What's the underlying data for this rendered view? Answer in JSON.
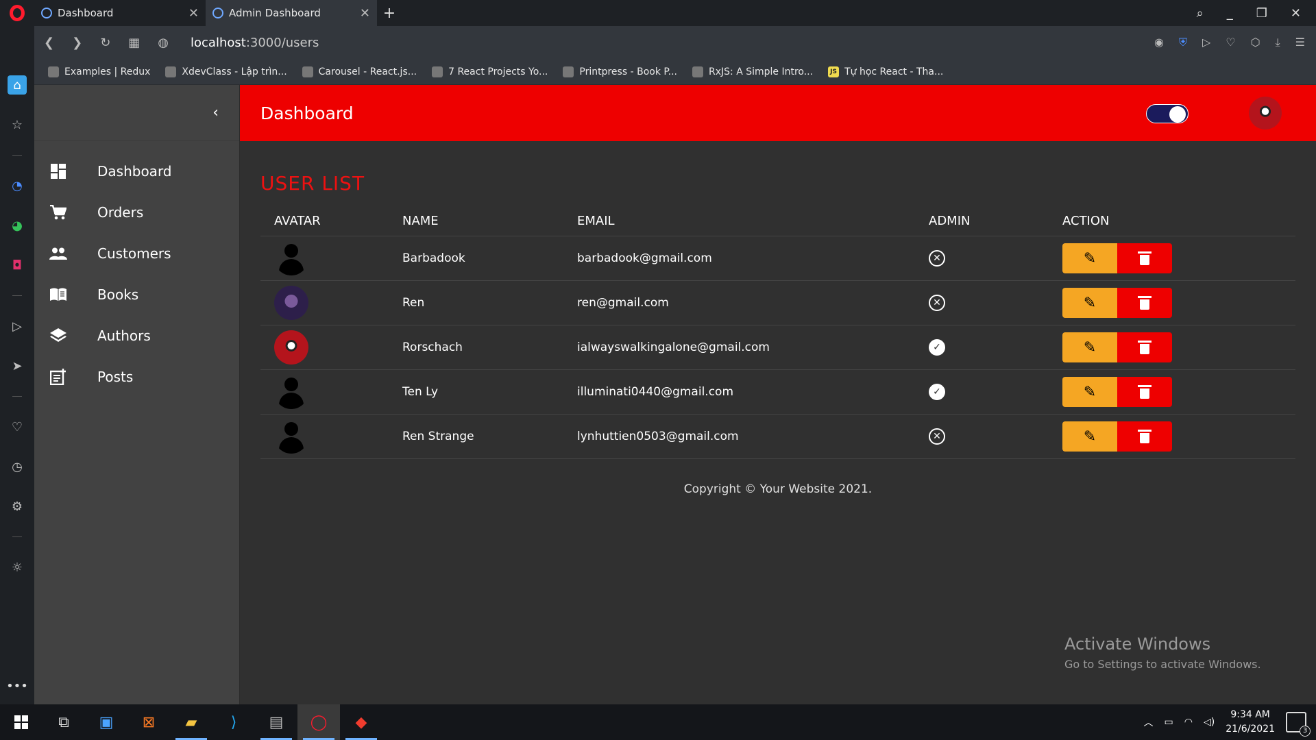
{
  "browser": {
    "tabs": [
      {
        "title": "Dashboard",
        "active": false
      },
      {
        "title": "Admin Dashboard",
        "active": true
      }
    ],
    "url_host": "localhost",
    "url_path": ":3000/users",
    "bookmarks": [
      "Examples | Redux",
      "XdevClass - Lập trìn...",
      "Carousel - React.js...",
      "7 React Projects Yo...",
      "Printpress - Book P...",
      "RxJS: A Simple Intro...",
      "Tự học React - Tha..."
    ]
  },
  "sidebar": {
    "items": [
      {
        "label": "Dashboard",
        "icon": "dashboard-icon"
      },
      {
        "label": "Orders",
        "icon": "cart-icon"
      },
      {
        "label": "Customers",
        "icon": "people-icon"
      },
      {
        "label": "Books",
        "icon": "book-icon"
      },
      {
        "label": "Authors",
        "icon": "layers-icon"
      },
      {
        "label": "Posts",
        "icon": "post-add-icon"
      }
    ]
  },
  "header": {
    "title": "Dashboard",
    "theme_toggle_on": true
  },
  "main": {
    "section_title": "USER LIST",
    "columns": [
      "AVATAR",
      "NAME",
      "EMAIL",
      "ADMIN",
      "ACTION"
    ],
    "users": [
      {
        "avatar": "default",
        "name": "Barbadook",
        "email": "barbadook@gmail.com",
        "admin": false
      },
      {
        "avatar": "owl",
        "name": "Ren",
        "email": "ren@gmail.com",
        "admin": false
      },
      {
        "avatar": "jack",
        "name": "Rorschach",
        "email": "ialwayswalkingalone@gmail.com",
        "admin": true
      },
      {
        "avatar": "default",
        "name": "Ten Ly",
        "email": "illuminati0440@gmail.com",
        "admin": true
      },
      {
        "avatar": "default",
        "name": "Ren Strange",
        "email": "lynhuttien0503@gmail.com",
        "admin": false
      }
    ],
    "copyright": "Copyright © Your Website 2021."
  },
  "watermark": {
    "title": "Activate Windows",
    "subtitle": "Go to Settings to activate Windows."
  },
  "taskbar": {
    "time": "9:34 AM",
    "date": "21/6/2021",
    "notification_count": "3"
  },
  "colors": {
    "header": "#ee0000",
    "title_red": "#ee1111",
    "edit": "#f5a623",
    "delete": "#ee0000",
    "sidebar": "#424242",
    "content": "#303030"
  }
}
